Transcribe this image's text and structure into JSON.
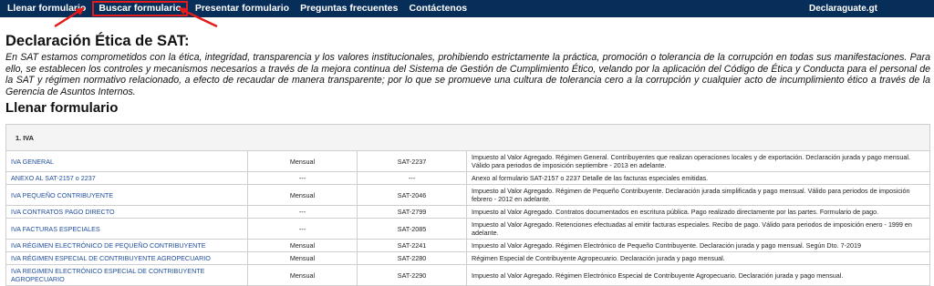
{
  "nav": {
    "items": [
      {
        "label": "Llenar formulario",
        "highlighted": false
      },
      {
        "label": "Buscar formulario",
        "highlighted": true
      },
      {
        "label": "Presentar formulario",
        "highlighted": false
      },
      {
        "label": "Preguntas frecuentes",
        "highlighted": false
      },
      {
        "label": "Contáctenos",
        "highlighted": false
      }
    ],
    "brand": "Declaraguate.gt"
  },
  "colors": {
    "nav_bg": "#072e58",
    "highlight": "#e31b1b",
    "link": "#1f4e9c"
  },
  "heading": "Declaración Ética de SAT:",
  "intro": "En SAT estamos comprometidos con la ética, integridad, transparencia y los valores institucionales, prohibiendo estrictamente la práctica, promoción o tolerancia de la corrupción en todas sus manifestaciones. Para ello, se establecen los controles y mecanismos necesarios a través de la mejora continua del Sistema de Gestión de Cumplimiento Ético, velando por la aplicación del Código de Ética y Conducta para el personal de la SAT y régimen normativo relacionado, a efecto de recaudar de manera transparente; por lo que se promueve una cultura de tolerancia cero a la corrupción y cualquier acto de incumplimiento ético a través de la Gerencia de Asuntos Internos.",
  "section_title": "Llenar formulario",
  "table": {
    "group": "1. IVA",
    "rows": [
      {
        "name": "IVA GENERAL",
        "period": "Mensual",
        "code": "SAT-2237",
        "desc": "Impuesto al Valor Agregado. Régimen General. Contribuyentes que realizan operaciones locales y de exportación. Declaración jurada y pago mensual. Válido para periodos de imposición septiembre - 2013 en adelante."
      },
      {
        "name": "ANEXO AL SAT-2157 o 2237",
        "period": "---",
        "code": "---",
        "desc": "Anexo al formulario SAT-2157 o 2237 Detalle de las facturas especiales emitidas."
      },
      {
        "name": "IVA PEQUEÑO CONTRIBUYENTE",
        "period": "Mensual",
        "code": "SAT-2046",
        "desc": "Impuesto al Valor Agregado. Régimen de Pequeño Contribuyente. Declaración jurada simplificada y pago mensual. Válido para periodos de imposición febrero - 2012 en adelante."
      },
      {
        "name": "IVA CONTRATOS PAGO DIRECTO",
        "period": "---",
        "code": "SAT-2799",
        "desc": "Impuesto al Valor Agregado. Contratos documentados en escritura pública. Pago realizado directamente por las partes. Formulario de pago."
      },
      {
        "name": "IVA FACTURAS ESPECIALES",
        "period": "---",
        "code": "SAT-2085",
        "desc": "Impuesto al Valor Agregado. Retenciones efectuadas al emitir facturas especiales. Recibo de pago. Válido para periodos de imposición enero - 1999 en adelante."
      },
      {
        "name": "IVA RÉGIMEN ELECTRÓNICO DE PEQUEÑO CONTRIBUYENTE",
        "period": "Mensual",
        "code": "SAT-2241",
        "desc": "Impuesto al Valor Agregado. Régimen Electrónico de Pequeño Contribuyente. Declaración jurada y pago mensual. Según Dto. 7-2019"
      },
      {
        "name": "IVA RÉGIMEN ESPECIAL DE CONTRIBUYENTE AGROPECUARIO",
        "period": "Mensual",
        "code": "SAT-2280",
        "desc": "Régimen Especial de Contribuyente Agropecuario. Declaración jurada y pago mensual."
      },
      {
        "name": "IVA REGIMEN ELECTRÓNICO ESPECIAL DE CONTRIBUYENTE AGROPECUARIO",
        "period": "Mensual",
        "code": "SAT-2290",
        "desc": "Impuesto al Valor Agregado. Régimen Electrónico Especial de Contribuyente Agropecuario. Declaración jurada y pago mensual."
      }
    ]
  }
}
